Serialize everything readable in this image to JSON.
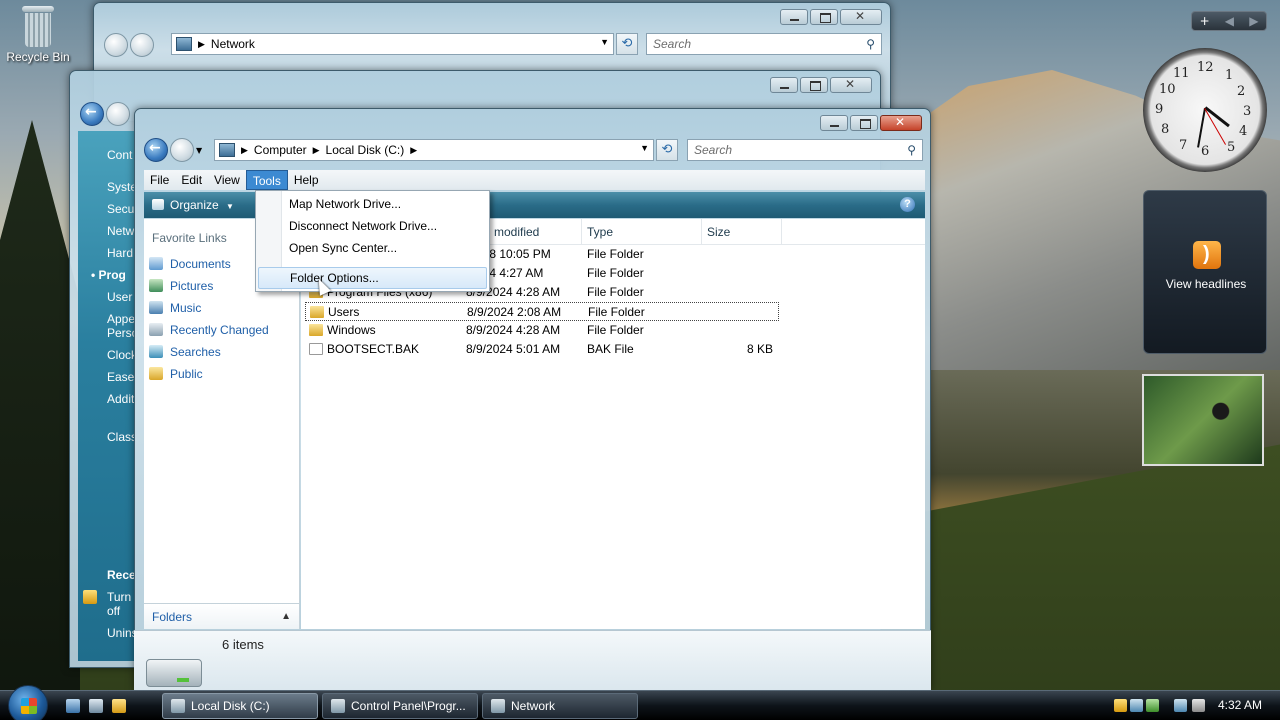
{
  "desktop": {
    "recycle_bin_label": "Recycle Bin"
  },
  "window_network": {
    "address": "Network",
    "search_placeholder": "Search"
  },
  "window_control_panel": {
    "sidebar_items": [
      "Cont",
      "Syste",
      "Secu",
      "Netw",
      "Hard",
      "Prog",
      "User",
      "Appe",
      "Perso",
      "Clock",
      "Ease",
      "Addit",
      "Class"
    ],
    "selected_item": "Prog",
    "recent_title": "Rece",
    "recent_items": [
      "Turn",
      "off",
      "Unins"
    ]
  },
  "explorer": {
    "address": {
      "crumbs": [
        "Computer",
        "Local Disk (C:)"
      ]
    },
    "search_placeholder": "Search",
    "menu": [
      "File",
      "Edit",
      "View",
      "Tools",
      "Help"
    ],
    "open_menu": "Tools",
    "organize_label": "Organize",
    "favorite_links_title": "Favorite Links",
    "favorite_links": [
      "Documents",
      "Pictures",
      "Music",
      "Recently Changed",
      "Searches",
      "Public"
    ],
    "folders_label": "Folders",
    "columns": [
      "modified",
      "Type",
      "Size"
    ],
    "files": [
      {
        "name": "",
        "date": "/2008 10:05 PM",
        "type": "File Folder",
        "size": ""
      },
      {
        "name": "",
        "date": "/2024 4:27 AM",
        "type": "File Folder",
        "size": ""
      },
      {
        "name": "Program Files (x86)",
        "date": "8/9/2024 4:28 AM",
        "type": "File Folder",
        "size": ""
      },
      {
        "name": "Users",
        "date": "8/9/2024 2:08 AM",
        "type": "File Folder",
        "size": ""
      },
      {
        "name": "Windows",
        "date": "8/9/2024 4:28 AM",
        "type": "File Folder",
        "size": ""
      },
      {
        "name": "BOOTSECT.BAK",
        "date": "8/9/2024 5:01 AM",
        "type": "BAK File",
        "size": "8 KB"
      }
    ],
    "item_count": "6 items"
  },
  "tools_menu": {
    "items": [
      "Map Network Drive...",
      "Disconnect Network Drive...",
      "Open Sync Center...",
      "Folder Options..."
    ],
    "highlighted": "Folder Options..."
  },
  "gadgets": {
    "add_symbol": "+",
    "clock_numbers": [
      "12",
      "1",
      "2",
      "3",
      "4",
      "5",
      "6",
      "7",
      "8",
      "9",
      "10",
      "11"
    ],
    "feed_label": "View headlines"
  },
  "taskbar": {
    "tasks": [
      "Local Disk (C:)",
      "Control Panel\\Progr...",
      "Network"
    ],
    "active_task": "Local Disk (C:)",
    "clock": "4:32 AM"
  }
}
